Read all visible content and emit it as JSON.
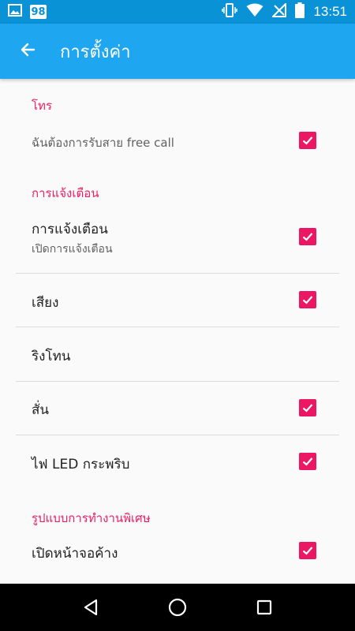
{
  "status_bar": {
    "notification_badge": "98",
    "time": "13:51",
    "icons": [
      "image-icon",
      "vibrate-icon",
      "wifi-icon",
      "no-sim-icon",
      "battery-icon"
    ]
  },
  "app_bar": {
    "title": "การตั้งค่า",
    "back_icon": "arrow-back-icon"
  },
  "sections": {
    "call": {
      "header": "โทร",
      "free_call_label": "ฉันต้องการรับสาย free call",
      "free_call_checked": true
    },
    "notifications": {
      "header": "การแจ้งเตือน",
      "notify_label": "การแจ้งเตือน",
      "notify_sub": "เปิดการแจ้งเตือน",
      "notify_checked": true,
      "sound_label": "เสียง",
      "sound_checked": true,
      "ringtone_label": "ริงโทน",
      "vibrate_label": "สั่น",
      "vibrate_checked": true,
      "led_label": "ไฟ LED กระพริบ",
      "led_checked": true
    },
    "special": {
      "header": "รูปแบบการทำงานพิเศษ",
      "screen_on_label": "เปิดหน้าจอค้าง",
      "screen_on_checked": true
    }
  },
  "nav_bar": {
    "icons": [
      "back-triangle-icon",
      "home-circle-icon",
      "recents-square-icon"
    ]
  },
  "colors": {
    "status_bar": "#0a92d6",
    "app_bar": "#1ea6f0",
    "accent": "#e91e63",
    "checkbox": "#ec1763",
    "background": "#fafafa"
  }
}
